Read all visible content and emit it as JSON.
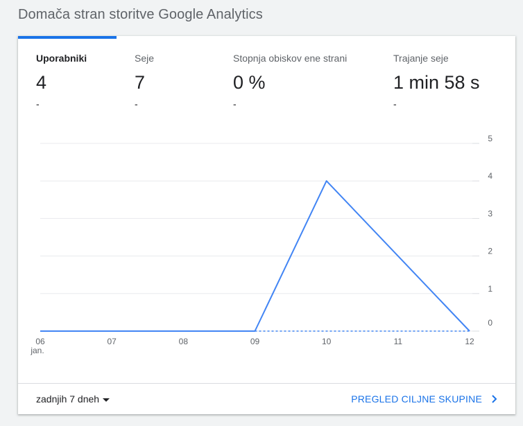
{
  "page": {
    "title": "Domača stran storitve Google Analytics"
  },
  "metrics": [
    {
      "label": "Uporabniki",
      "value": "4",
      "delta": "-",
      "active": true
    },
    {
      "label": "Seje",
      "value": "7",
      "delta": "-",
      "active": false
    },
    {
      "label": "Stopnja obiskov ene strani",
      "value": "0 %",
      "delta": "-",
      "active": false
    },
    {
      "label": "Trajanje seje",
      "value": "1 min 58 s",
      "delta": "-",
      "active": false
    }
  ],
  "chart_data": {
    "type": "line",
    "x": [
      "06",
      "07",
      "08",
      "09",
      "10",
      "11",
      "12"
    ],
    "x_sublabel": "jan.",
    "series": [
      {
        "values": [
          0,
          0,
          0,
          0,
          4,
          null,
          0
        ]
      }
    ],
    "ylim": [
      0,
      5
    ],
    "yticks": [
      0,
      1,
      2,
      3,
      4,
      5
    ],
    "y_axis_side": "right",
    "grid": true,
    "line_color": "#4285f4"
  },
  "footer": {
    "range_label": "zadnjih 7 dneh",
    "link_label": "PREGLED CILJNE SKUPINE"
  }
}
